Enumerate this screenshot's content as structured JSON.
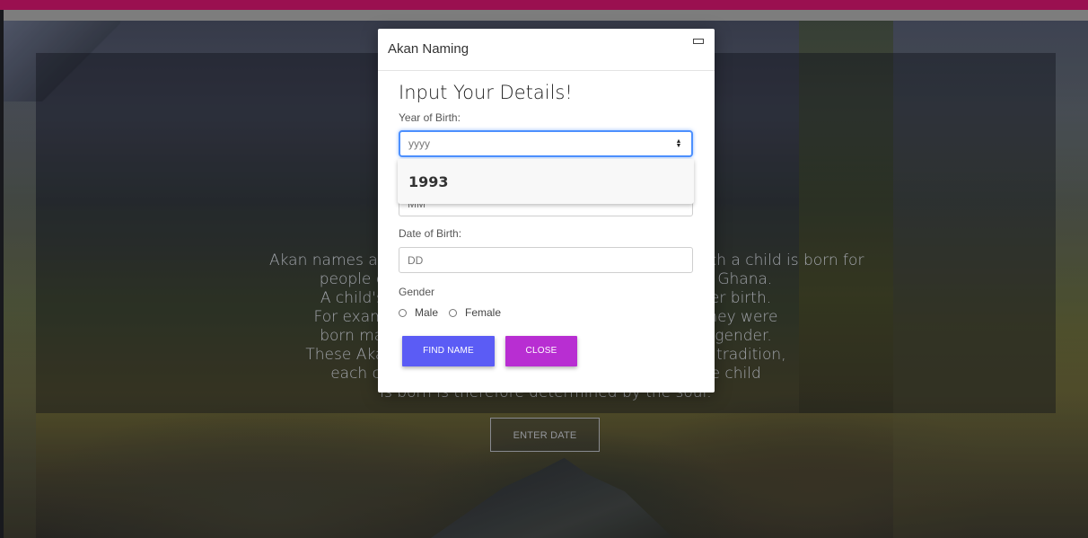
{
  "background": {
    "about_lines": [
      "Akan names are derived from the day of the week on which a child is born for",
      "people of the Akan ethnic group, located in parts of Ghana.",
      "A child's name is determined by the day of his or her birth.",
      "For example, children can be named after the day they were",
      "born may depend on the day of the week and their gender.",
      "These Akan names have meaning. According to Akan tradition,",
      "each child is born with a soul (kra) and the day the child",
      "is born is therefore determined by the soul."
    ],
    "enter_date_label": "ENTER DATE"
  },
  "modal": {
    "title": "Akan Naming",
    "heading": "Input Your Details!",
    "year": {
      "label": "Year of Birth:",
      "placeholder": "yyyy",
      "value": "",
      "suggestion": "1993"
    },
    "month": {
      "placeholder": "MM"
    },
    "date": {
      "label": "Date of Birth:",
      "placeholder": "DD"
    },
    "gender": {
      "label": "Gender",
      "options": [
        "Male",
        "Female"
      ]
    },
    "find_label": "FIND NAME",
    "close_label": "CLOSE"
  },
  "colors": {
    "top_bar": "#b0135c",
    "find_button": "#5b5cf5",
    "close_button": "#b82ed2",
    "focus_ring": "#4d90fe"
  }
}
